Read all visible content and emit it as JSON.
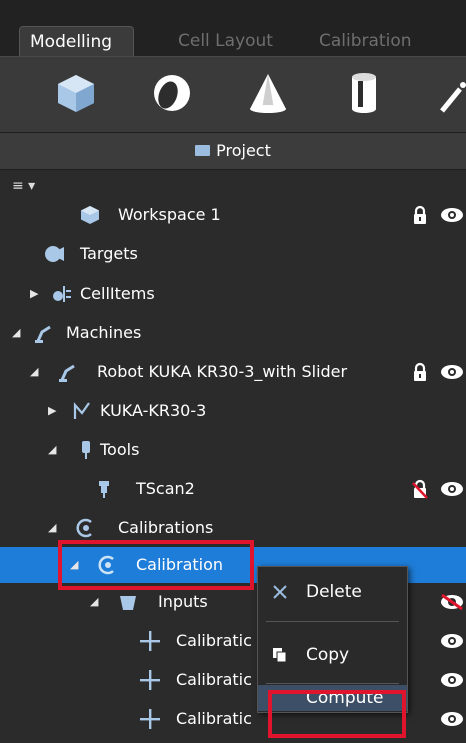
{
  "tabs": [
    {
      "label": "Modelling",
      "active": true
    },
    {
      "label": "Cell Layout",
      "active": false
    },
    {
      "label": "Calibration",
      "active": false
    }
  ],
  "toolbar": {
    "tools": [
      "cube-icon",
      "sphere-icon",
      "cone-icon",
      "cylinder-icon",
      "wand-icon"
    ]
  },
  "project": {
    "title": "Project"
  },
  "tree_menu_glyph": "≡ ▾",
  "tree": [
    {
      "label": "Workspace 1",
      "icon": "cube-icon",
      "locked": true,
      "visible": true
    },
    {
      "label": "Targets",
      "icon": "target-icon"
    },
    {
      "label": "CellItems",
      "icon": "cell-items-icon",
      "expanded": false
    },
    {
      "label": "Machines",
      "icon": "robot-arm-icon",
      "expanded": true
    },
    {
      "label": "Robot  KUKA KR30-3_with Slider",
      "icon": "robot-arm-icon",
      "expanded": true,
      "locked": true,
      "visible": true
    },
    {
      "label": "KUKA-KR30-3",
      "icon": "kinematics-icon",
      "expanded": false
    },
    {
      "label": "Tools",
      "icon": "tool-icon",
      "expanded": true
    },
    {
      "label": "TScan2",
      "icon": "scanner-icon",
      "lock_disabled": true,
      "visible": true
    },
    {
      "label": "Calibrations",
      "icon": "calibration-icon",
      "expanded": true
    },
    {
      "label": "Calibration",
      "icon": "calibration-icon",
      "expanded": true,
      "selected": true
    },
    {
      "label": "Inputs",
      "icon": "inputs-icon",
      "expanded": true,
      "hidden": true
    },
    {
      "label": "Calibratic",
      "icon": "plus-icon",
      "visible": true
    },
    {
      "label": "Calibratic",
      "icon": "plus-icon",
      "visible": true
    },
    {
      "label": "Calibratic",
      "icon": "plus-icon",
      "visible": true
    }
  ],
  "context_menu": {
    "delete": "Delete",
    "copy": "Copy",
    "compute": "Compute"
  },
  "colors": {
    "selection": "#1e7dd8",
    "highlight_box": "#e0142c",
    "accent_icon": "#9bbde0"
  }
}
